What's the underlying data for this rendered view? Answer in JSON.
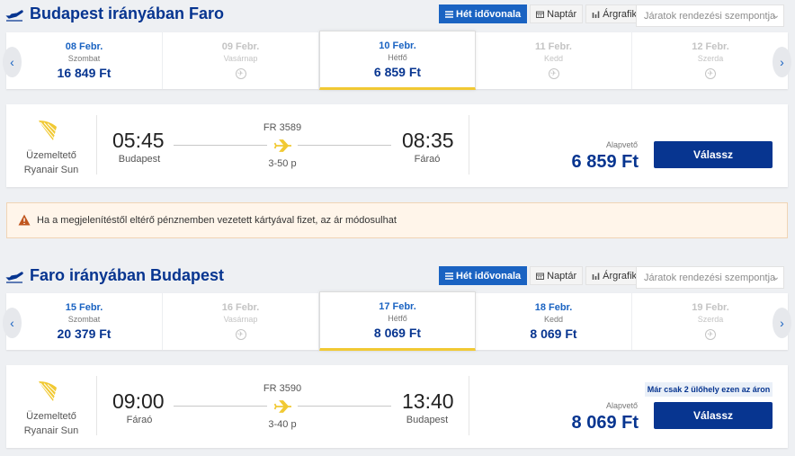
{
  "colors": {
    "brand": "#073590",
    "accent": "#1a63c2",
    "highlight": "#f1c933",
    "logo": "#f1c933"
  },
  "view_tabs": [
    {
      "label": "Hét idővonala",
      "icon": "list-icon",
      "active": true
    },
    {
      "label": "Naptár",
      "icon": "calendar-icon",
      "active": false
    },
    {
      "label": "Árgrafikon",
      "icon": "bar-chart-icon",
      "active": false
    }
  ],
  "sort_placeholder": "Járatok rendezési szempontja",
  "outbound": {
    "title": "Budapest irányában Faro",
    "days": [
      {
        "date": "08 Febr.",
        "weekday": "Szombat",
        "price": "16 849 Ft",
        "available": true
      },
      {
        "date": "09 Febr.",
        "weekday": "Vasárnap",
        "price": "",
        "available": false
      },
      {
        "date": "10 Febr.",
        "weekday": "Hétfő",
        "price": "6 859 Ft",
        "available": true,
        "selected": true
      },
      {
        "date": "11 Febr.",
        "weekday": "Kedd",
        "price": "",
        "available": false
      },
      {
        "date": "12 Febr.",
        "weekday": "Szerda",
        "price": "",
        "available": false
      }
    ],
    "flight": {
      "operator_label": "Üzemeltető",
      "operator": "Ryanair Sun",
      "dep_time": "05:45",
      "dep_city": "Budapest",
      "arr_time": "08:35",
      "arr_city": "Fáraó",
      "flight_no": "FR 3589",
      "duration": "3-50 p",
      "base_label": "Alapvető",
      "price": "6 859 Ft",
      "select_label": "Válassz",
      "seats_note": ""
    }
  },
  "notice": "Ha a megjelenítéstől eltérő pénznemben vezetett kártyával fizet, az ár módosulhat",
  "inbound": {
    "title": "Faro irányában Budapest",
    "days": [
      {
        "date": "15 Febr.",
        "weekday": "Szombat",
        "price": "20 379 Ft",
        "available": true
      },
      {
        "date": "16 Febr.",
        "weekday": "Vasárnap",
        "price": "",
        "available": false
      },
      {
        "date": "17 Febr.",
        "weekday": "Hétfő",
        "price": "8 069 Ft",
        "available": true,
        "selected": true
      },
      {
        "date": "18 Febr.",
        "weekday": "Kedd",
        "price": "8 069 Ft",
        "available": true
      },
      {
        "date": "19 Febr.",
        "weekday": "Szerda",
        "price": "",
        "available": false
      }
    ],
    "flight": {
      "operator_label": "Üzemeltető",
      "operator": "Ryanair Sun",
      "dep_time": "09:00",
      "dep_city": "Fáraó",
      "arr_time": "13:40",
      "arr_city": "Budapest",
      "flight_no": "FR 3590",
      "duration": "3-40 p",
      "base_label": "Alapvető",
      "price": "8 069 Ft",
      "select_label": "Válassz",
      "seats_note": "Már csak 2 ülőhely ezen az áron"
    }
  }
}
